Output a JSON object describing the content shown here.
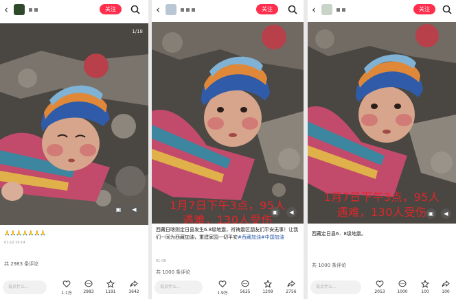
{
  "panels": [
    {
      "follow_label": "关注",
      "counter": "1/18",
      "caption": "🙏🙏🙏🙏🙏🙏🙏",
      "date": "01-10 19:14",
      "comments_total": "共 2983 条评论",
      "input_placeholder": "说点什么...",
      "actions": [
        "1.1万",
        "2983",
        "1191",
        "3642"
      ]
    },
    {
      "follow_label": "关注",
      "overlay_line1": "1月7日下午3点，95人",
      "overlay_line2": "遇难，130人受伤",
      "caption_text": "西藏日喀则定日县发生6.8级地震，祈祷震区朋友们平安无事！让我们一同为西藏加油，重建家园一切平安",
      "caption_tags": "#西藏加油#中国加油",
      "date": "01-08",
      "comments_total": "共 1000 条评论",
      "input_placeholder": "说点什么...",
      "actions": [
        "1.9万",
        "5625",
        "1209",
        "2756"
      ]
    },
    {
      "follow_label": "关注",
      "overlay_line1": "1月7日下午3点，95人",
      "overlay_line2": "遇难，130人受伤",
      "caption_text": "西藏定日县6．8级地震。",
      "comments_total": "共 1000 条评论",
      "input_placeholder": "说点什么...",
      "actions": [
        "2053",
        "1000",
        "100",
        "100"
      ]
    }
  ],
  "icons": {
    "back": "chevron-left-icon",
    "search": "search-icon",
    "like": "heart-icon",
    "comment": "comment-icon",
    "collect": "star-icon",
    "share": "share-icon"
  },
  "colors": {
    "follow_button": "#ff2e4d",
    "overlay_text": "#e2262b",
    "hashtag": "#2d5aa8"
  }
}
